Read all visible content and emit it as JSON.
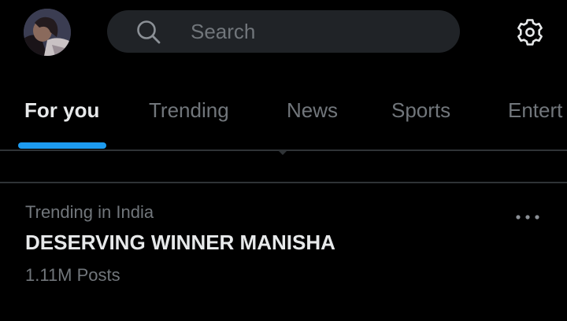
{
  "header": {
    "avatar_icon": "profile-avatar",
    "search": {
      "placeholder": "Search",
      "icon": "search-icon"
    },
    "settings_icon": "gear-icon"
  },
  "tabs": [
    {
      "label": "For you",
      "active": true
    },
    {
      "label": "Trending",
      "active": false
    },
    {
      "label": "News",
      "active": false
    },
    {
      "label": "Sports",
      "active": false
    },
    {
      "label": "Entert",
      "active": false
    }
  ],
  "trends": [
    {
      "context": "Trending in India",
      "title": "DESERVING WINNER MANISHA",
      "count": "1.11M Posts",
      "more_icon": "more-horizontal-icon"
    }
  ],
  "colors": {
    "background": "#000000",
    "accent": "#1d9bf0",
    "text_primary": "#e7e9ea",
    "text_secondary": "#71767b",
    "divider": "#2f3336",
    "search_bg": "#202327"
  }
}
